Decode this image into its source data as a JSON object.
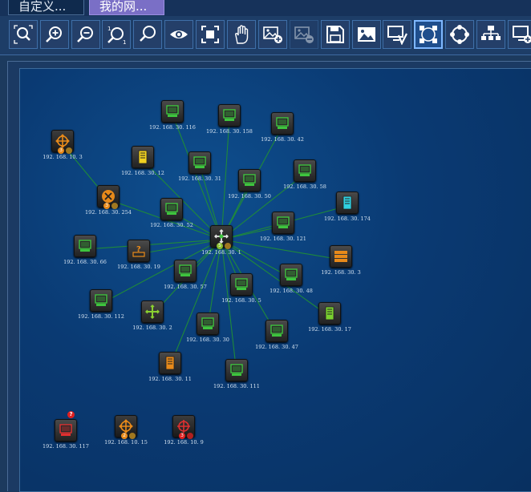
{
  "tabs": [
    {
      "label": "自定义..."
    },
    {
      "label": "我的网..."
    }
  ],
  "toolbar": [
    {
      "name": "zoom-select-icon"
    },
    {
      "name": "zoom-in-icon"
    },
    {
      "name": "zoom-out-icon"
    },
    {
      "name": "zoom-actual-icon"
    },
    {
      "name": "zoom-search-icon"
    },
    {
      "name": "eye-icon"
    },
    {
      "name": "fit-screen-icon"
    },
    {
      "name": "pan-hand-icon"
    },
    {
      "name": "add-image-icon"
    },
    {
      "name": "remove-image-icon"
    },
    {
      "name": "save-icon"
    },
    {
      "name": "background-image-icon"
    },
    {
      "name": "edit-device-icon"
    },
    {
      "name": "select-layout-icon"
    },
    {
      "name": "circle-layout-icon"
    },
    {
      "name": "tree-layout-icon"
    },
    {
      "name": "add-device-icon"
    }
  ],
  "topology": {
    "nodes": [
      {
        "id": "n1",
        "label": "192. 168. 30. 116",
        "type": "pc"
      },
      {
        "id": "n2",
        "label": "192. 168. 30. 158",
        "type": "pc"
      },
      {
        "id": "n3",
        "label": "192. 168. 30. 42",
        "type": "pc"
      },
      {
        "id": "n4",
        "label": "192. 168. 10. 3",
        "type": "router",
        "badge": "3"
      },
      {
        "id": "n5",
        "label": "192. 168. 30. 12",
        "type": "server-yellow"
      },
      {
        "id": "n6",
        "label": "192. 168. 30. 31",
        "type": "pc"
      },
      {
        "id": "n7",
        "label": "192. 168. 30. 50",
        "type": "pc"
      },
      {
        "id": "n8",
        "label": "192. 168. 30. 58",
        "type": "pc"
      },
      {
        "id": "n9",
        "label": "192. 168. 30. 254",
        "type": "router-x",
        "badge": "3"
      },
      {
        "id": "n10",
        "label": "192. 168. 30. 52",
        "type": "pc"
      },
      {
        "id": "n11",
        "label": "192. 168. 30. 174",
        "type": "server-cyan"
      },
      {
        "id": "n12",
        "label": "192. 168. 30. 121",
        "type": "pc"
      },
      {
        "id": "hub",
        "label": "192. 168. 30. 1",
        "type": "router-hub",
        "badge": "5"
      },
      {
        "id": "n13",
        "label": "192. 168. 30. 66",
        "type": "pc"
      },
      {
        "id": "n14",
        "label": "192. 168. 30. 19",
        "type": "unknown"
      },
      {
        "id": "n15",
        "label": "192. 168. 30. 3",
        "type": "storage"
      },
      {
        "id": "n16",
        "label": "192. 168. 30. 57",
        "type": "pc"
      },
      {
        "id": "n17",
        "label": "192. 168. 30. 48",
        "type": "pc"
      },
      {
        "id": "n18",
        "label": "192. 168. 30. 5",
        "type": "pc"
      },
      {
        "id": "n19",
        "label": "192. 168. 30. 112",
        "type": "pc"
      },
      {
        "id": "n20",
        "label": "192. 168. 30. 2",
        "type": "switch"
      },
      {
        "id": "n21",
        "label": "192. 168. 30. 17",
        "type": "server-green"
      },
      {
        "id": "n22",
        "label": "192. 168. 30. 30",
        "type": "pc"
      },
      {
        "id": "n23",
        "label": "192. 168. 30. 47",
        "type": "pc"
      },
      {
        "id": "n24",
        "label": "192. 168. 30. 11",
        "type": "server-orange"
      },
      {
        "id": "n25",
        "label": "192. 168. 30. 111",
        "type": "pc"
      },
      {
        "id": "n26",
        "label": "192. 168. 30. 117",
        "type": "pc-alert",
        "alert": "?"
      },
      {
        "id": "n27",
        "label": "192. 168. 10. 15",
        "type": "router",
        "badge": "2"
      },
      {
        "id": "n28",
        "label": "192. 168. 10. 9",
        "type": "router-red",
        "badge": "3"
      }
    ]
  },
  "colors": {
    "link": "#1f8a3a",
    "pc_screen": "#3ec43e",
    "router": "#e88a1a",
    "alert": "#e02020"
  }
}
